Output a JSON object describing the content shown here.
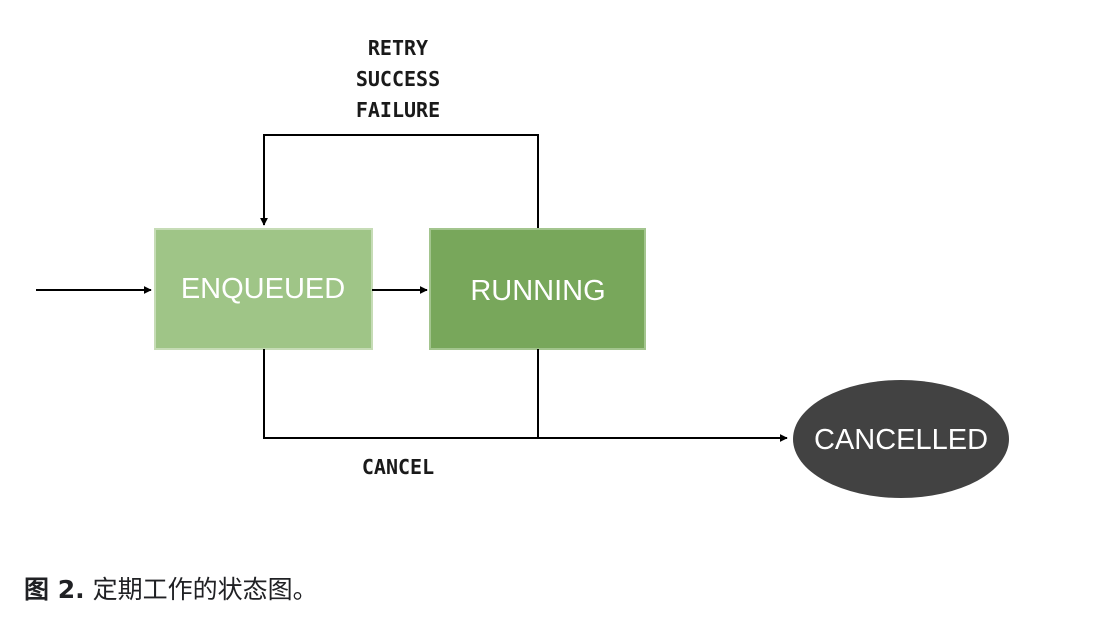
{
  "diagram": {
    "states": {
      "enqueued": "ENQUEUED",
      "running": "RUNNING",
      "cancelled": "CANCELLED"
    },
    "transitions": {
      "loop_labels": [
        "RETRY",
        "SUCCESS",
        "FAILURE"
      ],
      "cancel_label": "CANCEL"
    },
    "colors": {
      "enqueued_fill": "#9fc587",
      "enqueued_border": "#c6dcb6",
      "running_fill": "#78a75b",
      "running_border": "#a3c58e",
      "cancelled_fill": "#424242",
      "arrow": "#000000"
    }
  },
  "caption": {
    "figure_label": "图 2.",
    "text": "定期工作的状态图。"
  }
}
